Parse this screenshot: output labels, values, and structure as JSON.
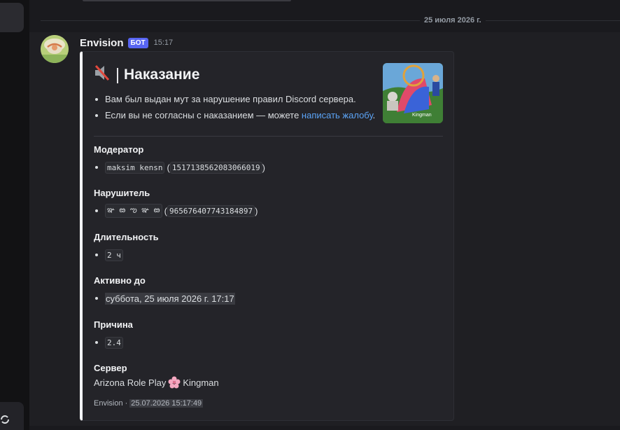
{
  "date_separator": "25 июля 2026 г.",
  "message": {
    "username": "Envision",
    "bot_tag": "БОТ",
    "time": "15:17"
  },
  "embed": {
    "title_icon": "muted-speaker-icon",
    "title_sep": "|",
    "title": "Наказание",
    "desc_line1": "Вам был выдан мут за нарушение правил Discord сервера.",
    "desc_line2_prefix": "Если вы не согласны с наказанием — можете ",
    "desc_line2_link": "написать жалобу",
    "desc_line2_suffix": ".",
    "fields": {
      "moderator": {
        "name": "Модератор",
        "code": "maksim kensn",
        "paren_open": "(",
        "id": "1517138562083066019",
        "paren_close": ")"
      },
      "violator": {
        "name": "Нарушитель",
        "code": "ఞ ఴ ఌ ఞ ఴ",
        "paren_open": "(",
        "id": "965676407743184897",
        "paren_close": ")"
      },
      "duration": {
        "name": "Длительность",
        "code": "2 ч"
      },
      "active_until": {
        "name": "Активно до",
        "value": "суббота, 25 июля 2026 г. 17:17"
      },
      "reason": {
        "name": "Причина",
        "code": "2.4"
      },
      "server": {
        "name": "Сервер",
        "value_prefix": "Arizona Role Play",
        "value_suffix": "Kingman",
        "flower_icon": "cherry-blossom-icon"
      }
    },
    "footer_name": "Envision",
    "footer_sep": "·",
    "footer_ts": "25.07.2026 15:17:49",
    "colors": {
      "accent_bar": "#f2f3f5",
      "link": "#5ba3f5",
      "bot_tag": "#5865f2"
    }
  },
  "sidebar": {
    "bottom_icon": "refresh-icon"
  }
}
